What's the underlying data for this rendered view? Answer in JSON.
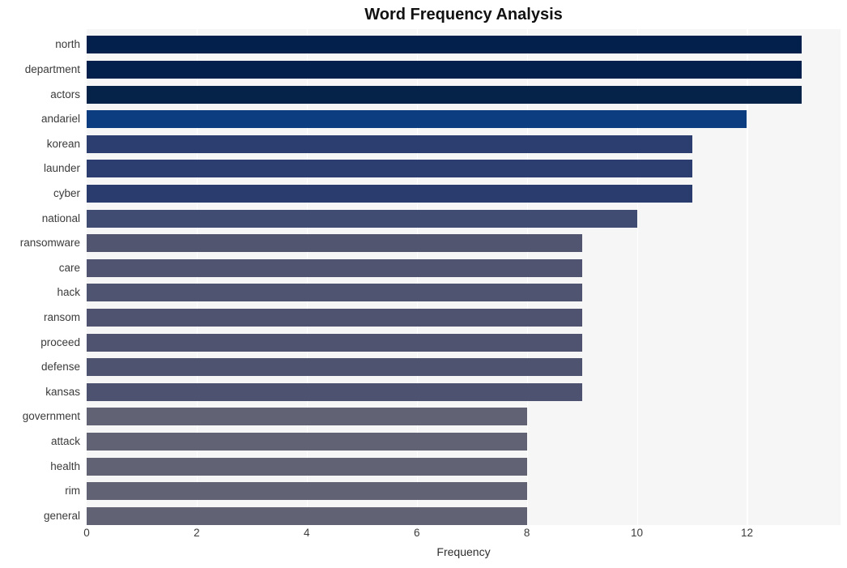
{
  "chart_data": {
    "type": "bar",
    "orientation": "horizontal",
    "title": "Word Frequency Analysis",
    "xlabel": "Frequency",
    "ylabel": "",
    "xlim": [
      0,
      13.7
    ],
    "ylim": [
      0,
      20
    ],
    "grid": true,
    "legend": false,
    "xticks": [
      "0",
      "2",
      "4",
      "6",
      "8",
      "10",
      "12"
    ],
    "xtick_values": [
      0,
      2,
      4,
      6,
      8,
      10,
      12
    ],
    "categories": [
      "north",
      "department",
      "actors",
      "andariel",
      "korean",
      "launder",
      "cyber",
      "national",
      "ransomware",
      "care",
      "hack",
      "ransom",
      "proceed",
      "defense",
      "kansas",
      "government",
      "attack",
      "health",
      "rim",
      "general"
    ],
    "values": [
      13,
      13,
      13,
      12,
      11,
      11,
      11,
      10,
      9,
      9,
      9,
      9,
      9,
      9,
      9,
      8,
      8,
      8,
      8,
      8
    ],
    "bar_colors": [
      "#03204c",
      "#03204c",
      "#052349",
      "#0b3d80",
      "#2c3e70",
      "#2c3e70",
      "#2a3c6d",
      "#414c72",
      "#515570",
      "#505470",
      "#4f5470",
      "#4f5370",
      "#4f5370",
      "#4e5370",
      "#4d5270",
      "#616274",
      "#616274",
      "#616274",
      "#616274",
      "#616274"
    ],
    "plot_background": "#f6f6f7",
    "gridline_color": "#ffffff",
    "figure_background": "#ffffff"
  }
}
